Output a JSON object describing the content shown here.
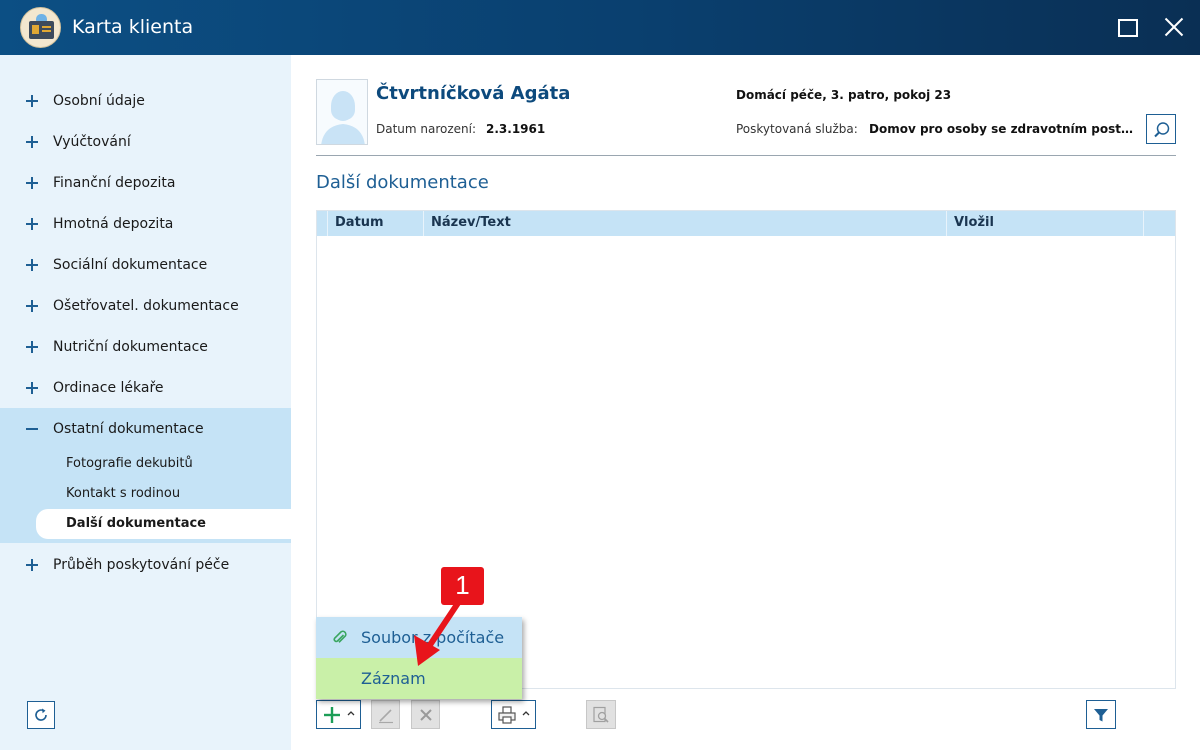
{
  "window": {
    "title": "Karta klienta"
  },
  "sidebar": {
    "items": [
      {
        "label": "Osobní údaje"
      },
      {
        "label": "Vyúčtování"
      },
      {
        "label": "Finanční depozita"
      },
      {
        "label": "Hmotná depozita"
      },
      {
        "label": "Sociální dokumentace"
      },
      {
        "label": "Ošetřovatel. dokumentace"
      },
      {
        "label": "Nutriční dokumentace"
      },
      {
        "label": "Ordinace lékaře"
      },
      {
        "label": "Ostatní dokumentace"
      },
      {
        "label": "Průběh poskytování péče"
      }
    ],
    "subitems": [
      {
        "label": "Fotografie dekubitů"
      },
      {
        "label": "Kontakt s rodinou"
      },
      {
        "label": "Další dokumentace"
      }
    ]
  },
  "client": {
    "name": "Čtvrtníčková Agáta",
    "dob_label": "Datum narození:",
    "dob": "2.3.1961",
    "location": "Domácí péče, 3. patro, pokoj 23",
    "service_label": "Poskytovaná služba:",
    "service": "Domov pro osoby se zdravotním postižením"
  },
  "section": {
    "title": "Další dokumentace"
  },
  "table": {
    "columns": [
      "Datum",
      "Název/Text",
      "Vložil"
    ],
    "rows": []
  },
  "dropdown": {
    "items": [
      {
        "label": "Soubor z počítače"
      },
      {
        "label": "Záznam"
      }
    ]
  },
  "annotation": {
    "label": "1"
  },
  "colors": {
    "titlebar": "#0c4f84",
    "accent": "#1e5f94",
    "sidebar": "#e8f3fb",
    "selected": "#c5e3f6",
    "highlight": "#c9f0a8",
    "annotation": "#e8141b"
  }
}
